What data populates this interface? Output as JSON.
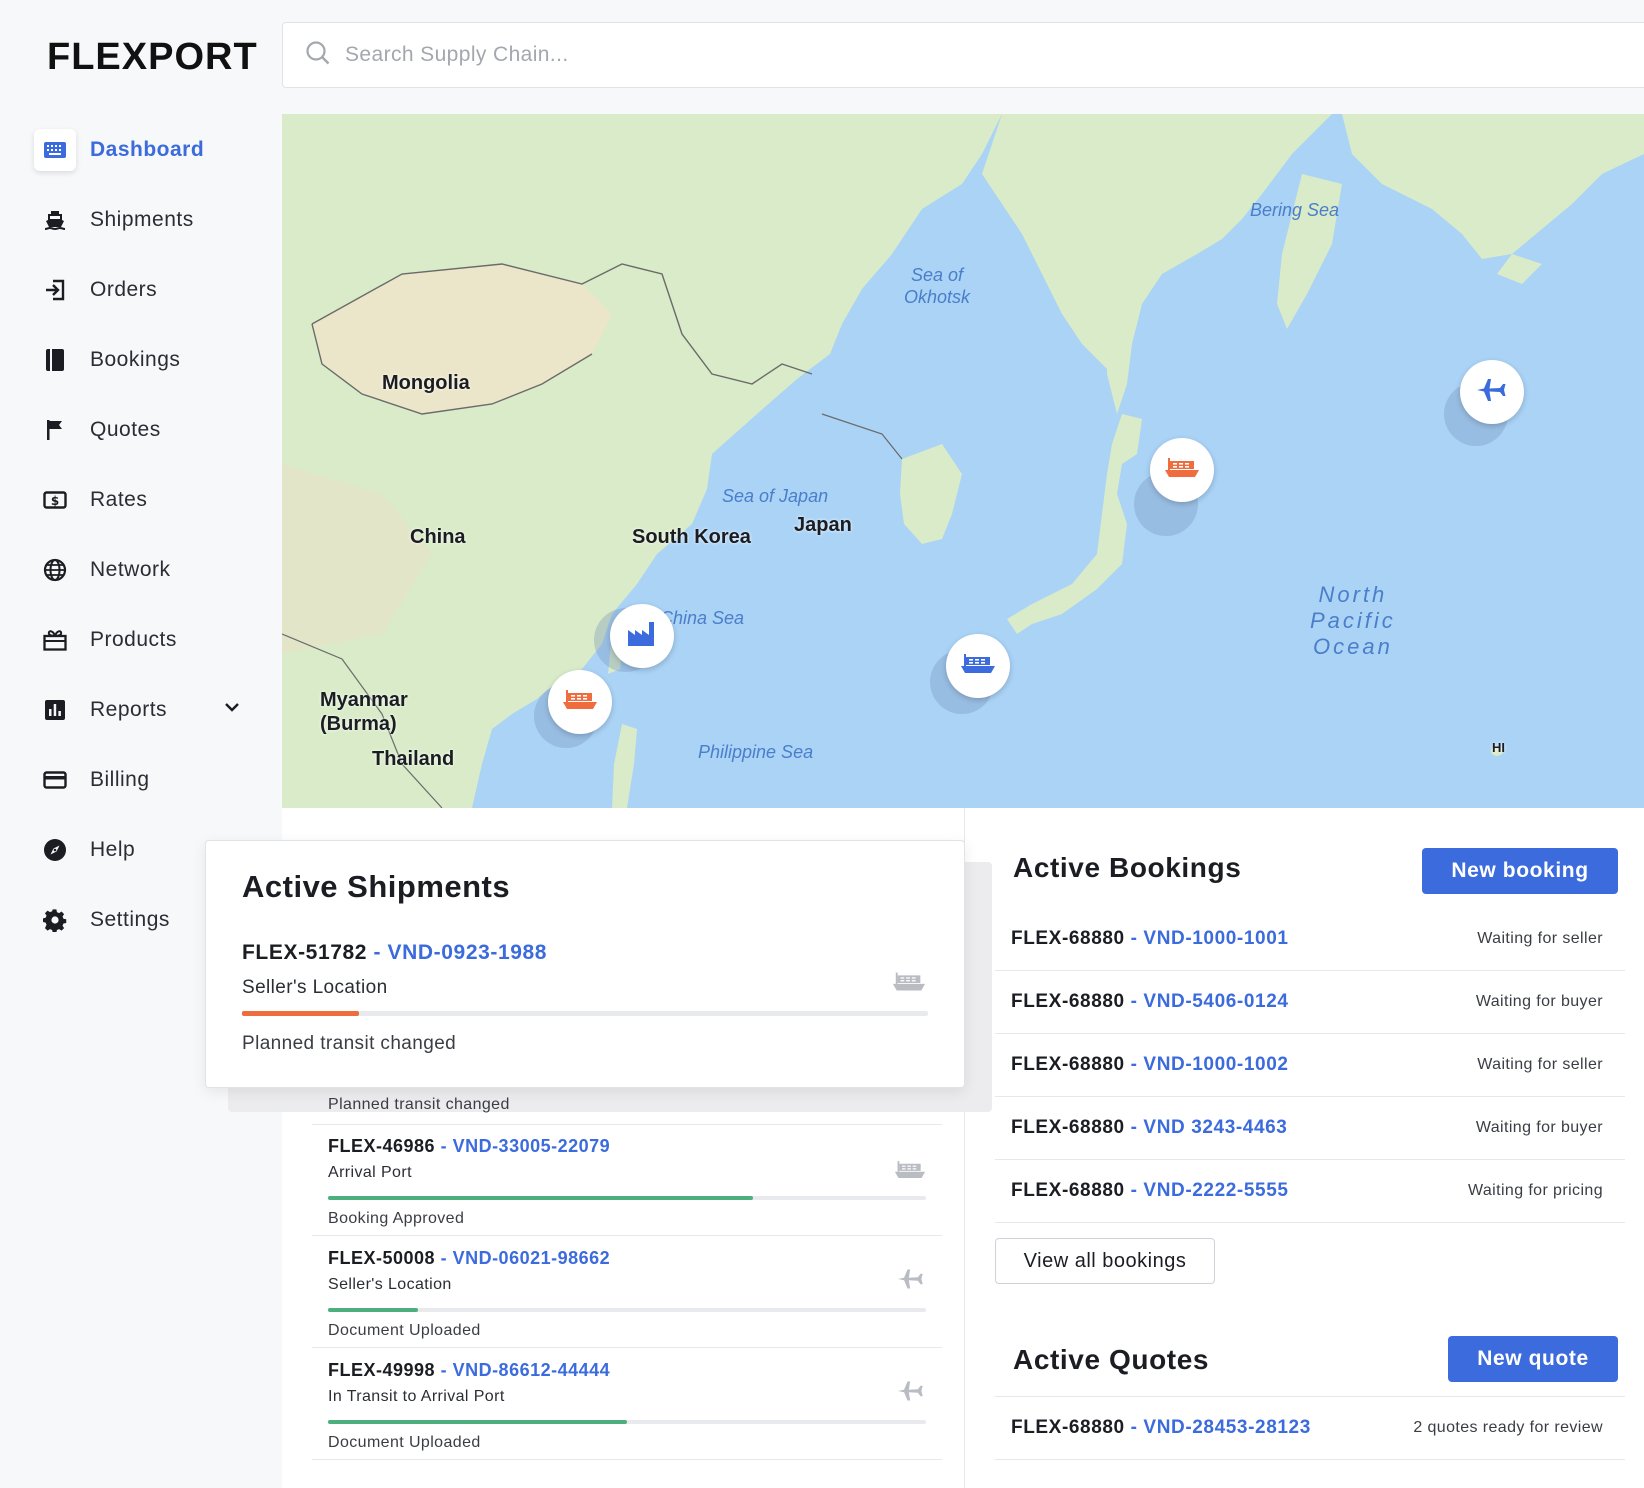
{
  "brand": {
    "logo": "FLEXPORT"
  },
  "search": {
    "placeholder": "Search Supply Chain..."
  },
  "sidebar": {
    "items": [
      {
        "label": "Dashboard",
        "icon": "keyboard-icon",
        "active": true
      },
      {
        "label": "Shipments",
        "icon": "ship-icon"
      },
      {
        "label": "Orders",
        "icon": "sign-in-icon"
      },
      {
        "label": "Bookings",
        "icon": "book-icon"
      },
      {
        "label": "Quotes",
        "icon": "flag-icon"
      },
      {
        "label": "Rates",
        "icon": "dollar-bill-icon"
      },
      {
        "label": "Network",
        "icon": "globe-icon"
      },
      {
        "label": "Products",
        "icon": "gift-box-icon"
      },
      {
        "label": "Reports",
        "icon": "bar-chart-icon",
        "expandable": true
      },
      {
        "label": "Billing",
        "icon": "credit-card-icon"
      },
      {
        "label": "Help",
        "icon": "compass-icon"
      },
      {
        "label": "Settings",
        "icon": "gear-icon"
      }
    ]
  },
  "map": {
    "countries": [
      "Mongolia",
      "China",
      "South Korea",
      "Japan",
      "Myanmar (Burma)",
      "Thailand"
    ],
    "myanmar_line1": "Myanmar",
    "myanmar_line2": "(Burma)",
    "water": {
      "bering": "Bering Sea",
      "okhotsk1": "Sea of",
      "okhotsk2": "Okhotsk",
      "japan": "Sea of Japan",
      "china": "China Sea",
      "philippine": "Philippine Sea",
      "pacific1": "North",
      "pacific2": "Pacific",
      "pacific3": "Ocean"
    },
    "hi": "HI",
    "markers": [
      "factory-icon",
      "ship-icon",
      "ship-icon",
      "ship-icon",
      "plane-icon"
    ],
    "colors": {
      "water": "#aad3f6",
      "land": "#d9ebc8",
      "orange": "#ef6c3e",
      "blue": "#3b6bdc"
    }
  },
  "active_shipments": {
    "title": "Active Shipments",
    "featured": {
      "id": "FLEX-51782",
      "ref": "VND-0923-1988",
      "location": "Seller's Location",
      "status": "Planned transit changed",
      "progress": 0.17,
      "mode_icon": "ship-icon"
    },
    "behind_status": "Planned transit changed",
    "rows": [
      {
        "id": "FLEX-46986",
        "ref": "VND-33005-22079",
        "location": "Arrival Port",
        "status": "Booking Approved",
        "progress": 0.71,
        "mode_icon": "ship-icon"
      },
      {
        "id": "FLEX-50008",
        "ref": "VND-06021-98662",
        "location": "Seller's Location",
        "status": "Document Uploaded",
        "progress": 0.15,
        "mode_icon": "plane-icon"
      },
      {
        "id": "FLEX-49998",
        "ref": "VND-86612-44444",
        "location": "In Transit to Arrival Port",
        "status": "Document Uploaded",
        "progress": 0.5,
        "mode_icon": "plane-icon"
      }
    ]
  },
  "active_bookings": {
    "title": "Active Bookings",
    "new_button": "New booking",
    "view_all": "View all bookings",
    "rows": [
      {
        "id": "FLEX-68880",
        "ref": "VND-1000-1001",
        "status": "Waiting for seller"
      },
      {
        "id": "FLEX-68880",
        "ref": "VND-5406-0124",
        "status": "Waiting for buyer"
      },
      {
        "id": "FLEX-68880",
        "ref": "VND-1000-1002",
        "status": "Waiting for seller"
      },
      {
        "id": "FLEX-68880",
        "ref": "VND 3243-4463",
        "status": "Waiting for buyer"
      },
      {
        "id": "FLEX-68880",
        "ref": "VND-2222-5555",
        "status": "Waiting for pricing"
      }
    ]
  },
  "active_quotes": {
    "title": "Active Quotes",
    "new_button": "New quote",
    "rows": [
      {
        "id": "FLEX-68880",
        "ref": "VND-28453-28123",
        "status": "2 quotes ready for review"
      }
    ]
  },
  "separator": " - ",
  "colors": {
    "accent": "#3b6bdc",
    "orange": "#ef6c3e",
    "green": "#4caf7d"
  }
}
